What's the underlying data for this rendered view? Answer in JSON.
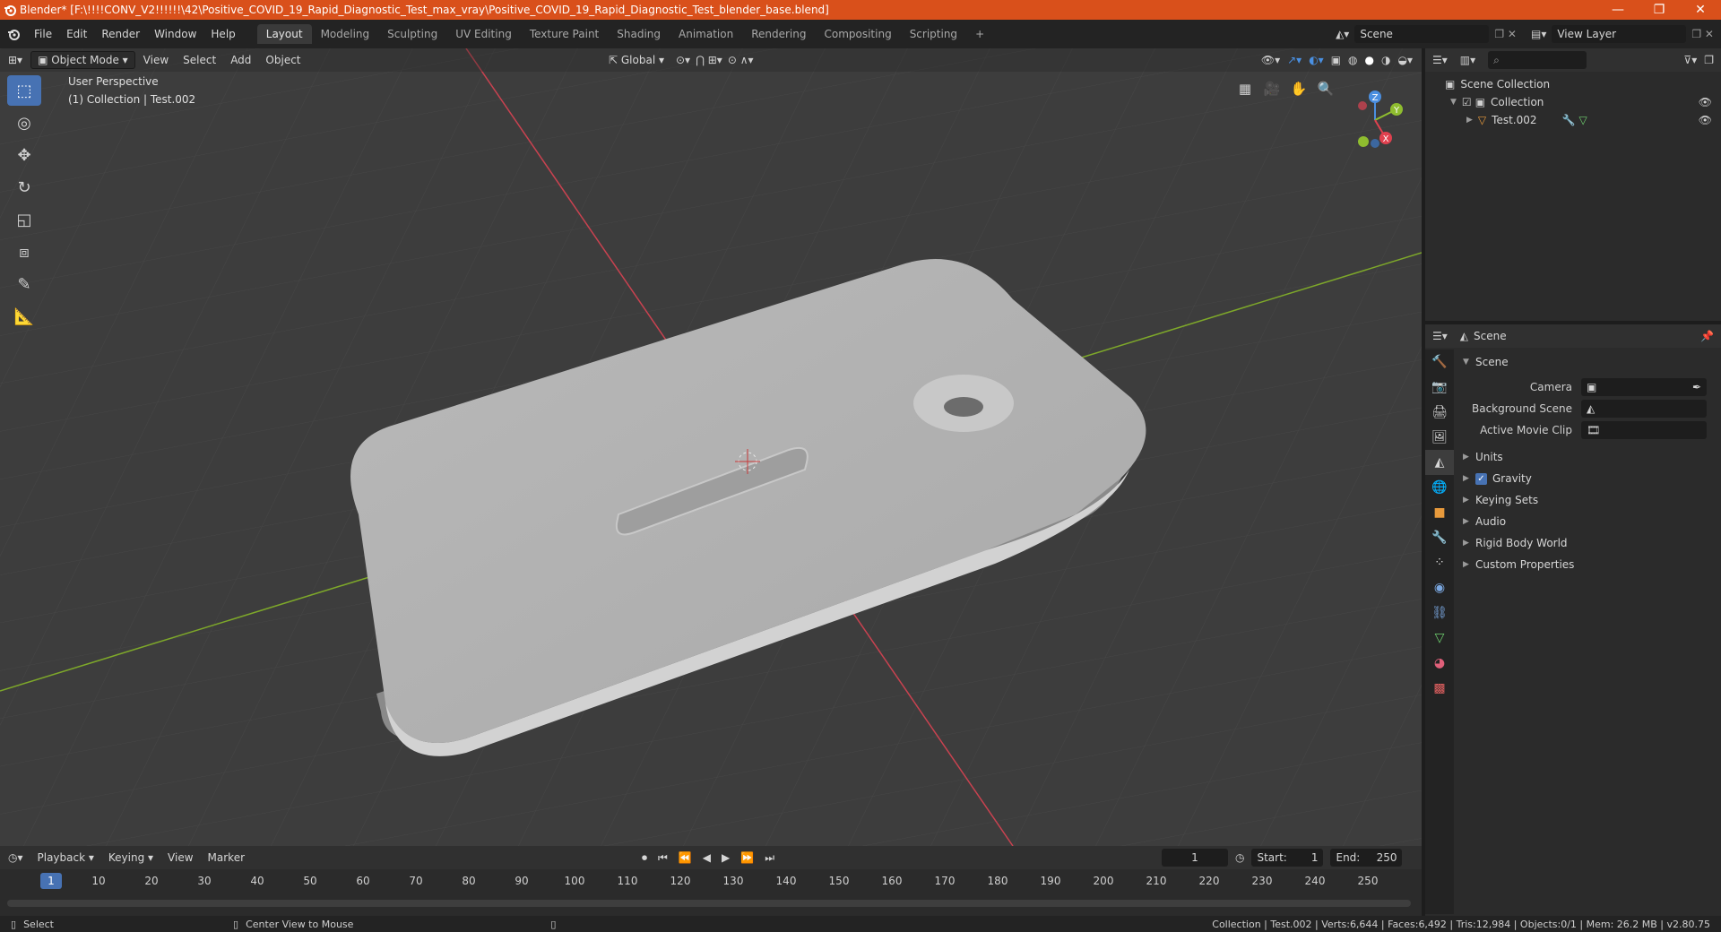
{
  "window": {
    "title": "Blender* [F:\\!!!!CONV_V2!!!!!!\\42\\Positive_COVID_19_Rapid_Diagnostic_Test_max_vray\\Positive_COVID_19_Rapid_Diagnostic_Test_blender_base.blend]",
    "controls": [
      "—",
      "❐",
      "✕"
    ]
  },
  "menubar": {
    "menus": [
      "File",
      "Edit",
      "Render",
      "Window",
      "Help"
    ],
    "workspaces": [
      "Layout",
      "Modeling",
      "Sculpting",
      "UV Editing",
      "Texture Paint",
      "Shading",
      "Animation",
      "Rendering",
      "Compositing",
      "Scripting"
    ],
    "active_workspace": "Layout",
    "add_workspace": "+",
    "scene_name": "Scene",
    "view_layer_name": "View Layer"
  },
  "viewport": {
    "mode": "Object Mode",
    "menus": [
      "View",
      "Select",
      "Add",
      "Object"
    ],
    "transform_orientation": "Global",
    "overlay_title": "User Perspective",
    "overlay_collection": "(1) Collection | Test.002",
    "gizmo_axes": [
      "X",
      "Y",
      "Z"
    ]
  },
  "outliner": {
    "root": "Scene Collection",
    "collection": "Collection",
    "object": "Test.002"
  },
  "properties": {
    "header_title": "Scene",
    "panel_title": "Scene",
    "camera_label": "Camera",
    "background_scene_label": "Background Scene",
    "active_movie_clip_label": "Active Movie Clip",
    "subpanels": [
      "Units",
      "Gravity",
      "Keying Sets",
      "Audio",
      "Rigid Body World",
      "Custom Properties"
    ],
    "gravity_checked": true
  },
  "timeline": {
    "menus": [
      "Playback",
      "Keying",
      "View",
      "Marker"
    ],
    "current_frame": "1",
    "start_label": "Start:",
    "start_value": "1",
    "end_label": "End:",
    "end_value": "250",
    "ruler": [
      "1",
      "10",
      "20",
      "30",
      "40",
      "50",
      "60",
      "70",
      "80",
      "90",
      "100",
      "110",
      "120",
      "130",
      "140",
      "150",
      "160",
      "170",
      "180",
      "190",
      "200",
      "210",
      "220",
      "230",
      "240",
      "250"
    ]
  },
  "statusbar": {
    "left_action": "Select",
    "middle_action": "Center View to Mouse",
    "stats": "Collection | Test.002 | Verts:6,644 | Faces:6,492 | Tris:12,984 | Objects:0/1 | Mem: 26.2 MB | v2.80.75"
  },
  "colors": {
    "titlebar": "#d9501b",
    "accent": "#4772b3",
    "viewport_bg": "#3d3d3d",
    "panel_bg": "#2b2b2b",
    "x_axis": "#e0414f",
    "y_axis": "#8fbd2f",
    "z_axis": "#4b8fe0"
  }
}
